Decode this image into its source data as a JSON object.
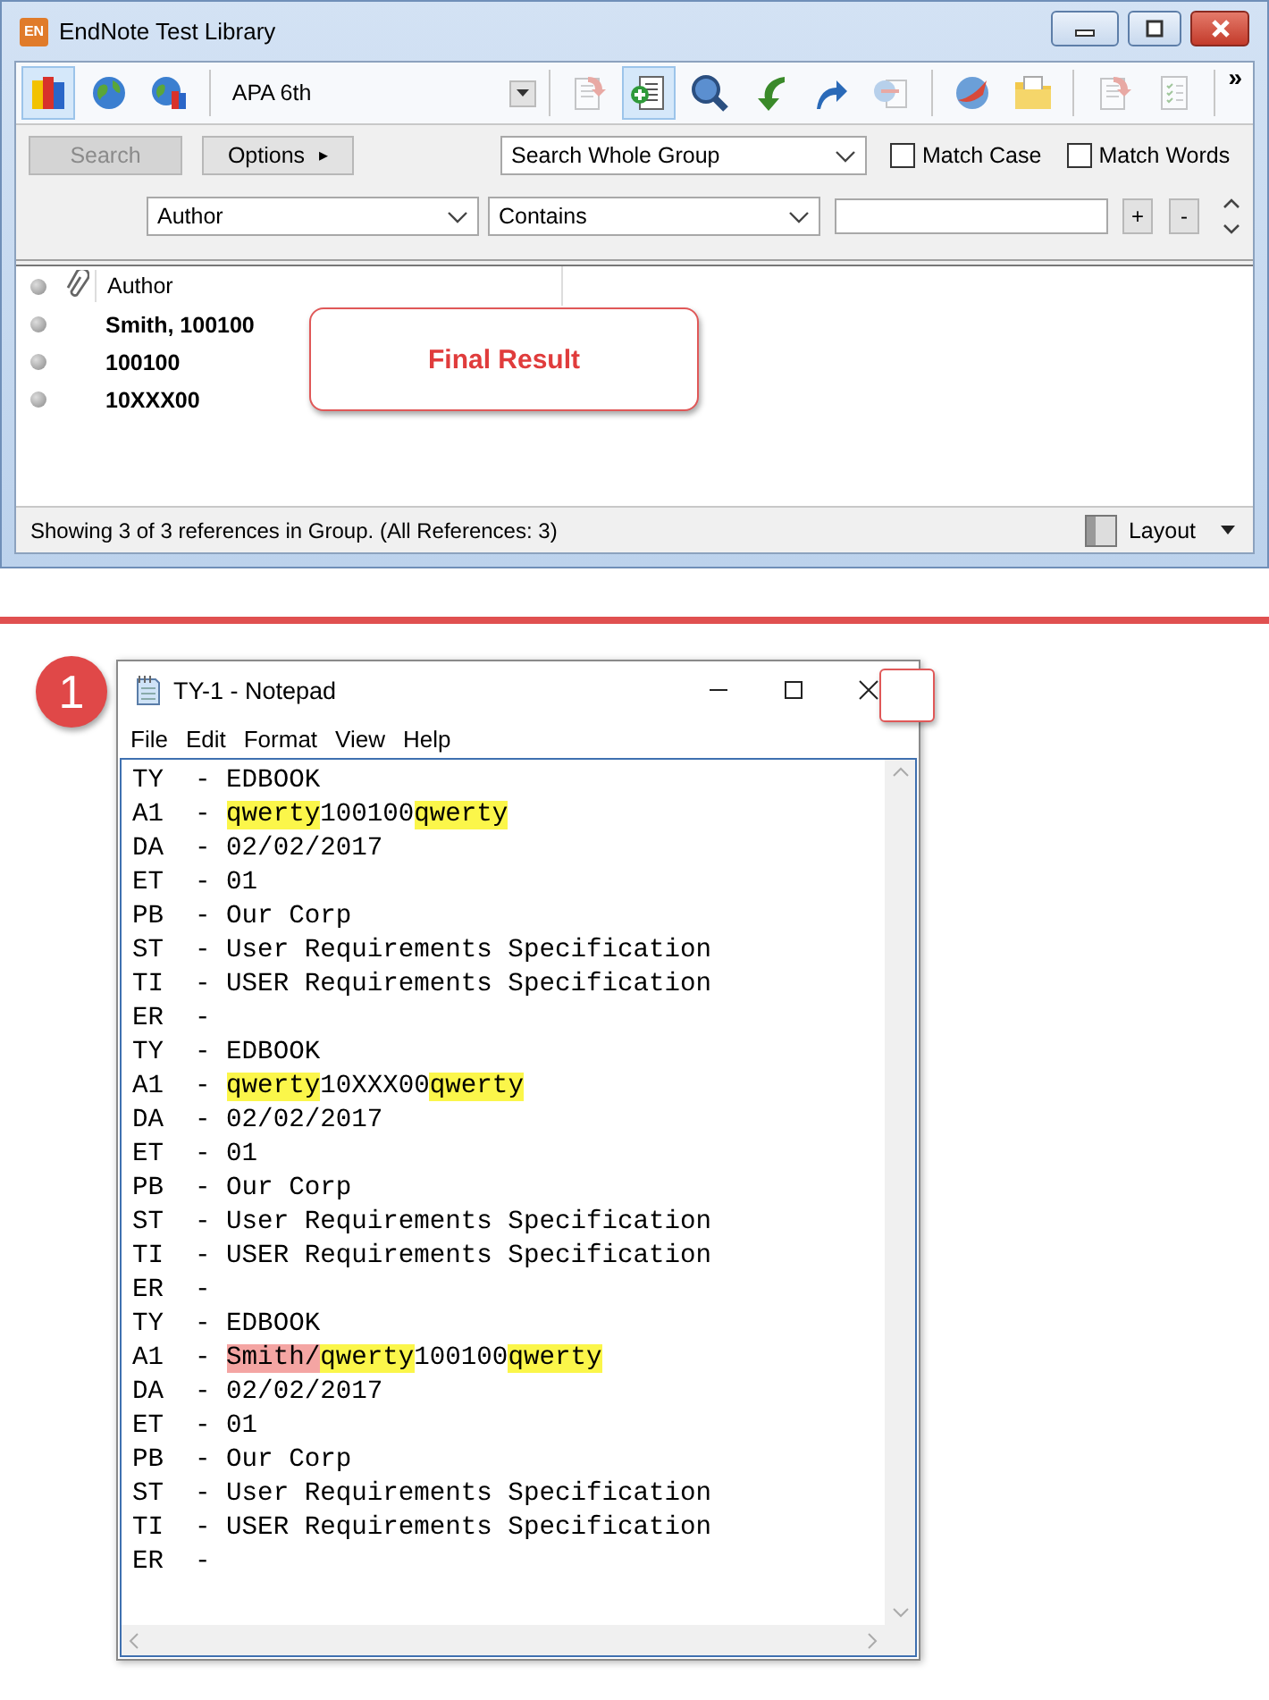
{
  "endnote_window": {
    "title": "EndNote Test Library",
    "app_icon_text": "EN",
    "toolbar_left": [
      {
        "kind": "books",
        "selected": true,
        "disabled": false
      },
      {
        "kind": "globe",
        "selected": false,
        "disabled": false
      },
      {
        "kind": "globe-books",
        "selected": false,
        "disabled": false
      }
    ],
    "style_select": {
      "value": "APA 6th"
    },
    "toolbar_right": [
      {
        "kind": "document-arrow",
        "selected": false,
        "disabled": true
      },
      {
        "kind": "add-document",
        "selected": true,
        "disabled": false
      },
      {
        "kind": "magnifier",
        "selected": false,
        "disabled": false
      },
      {
        "kind": "green-arrow",
        "selected": false,
        "disabled": false
      },
      {
        "kind": "blue-arrow",
        "selected": false,
        "disabled": false
      },
      {
        "kind": "globe-document",
        "selected": false,
        "disabled": true
      },
      {
        "kind": "globe-swoosh",
        "selected": false,
        "disabled": false
      },
      {
        "kind": "folder",
        "selected": false,
        "disabled": false
      },
      {
        "kind": "document-arrow",
        "selected": false,
        "disabled": true
      },
      {
        "kind": "checklist",
        "selected": false,
        "disabled": true
      }
    ],
    "toolbar_overflow": "»",
    "search_panel": {
      "search_button": {
        "label": "Search",
        "disabled": true
      },
      "options_button": {
        "label": "Options",
        "caret": "▸"
      },
      "scope_select": {
        "value": "Search Whole Group"
      },
      "checkboxes": [
        {
          "label": "Match Case",
          "checked": false
        },
        {
          "label": "Match Words",
          "checked": false
        }
      ],
      "field_select": {
        "value": "Author"
      },
      "operator_select": {
        "value": "Contains"
      },
      "add_button": "+",
      "remove_button": "-"
    },
    "reference_list": {
      "columns": [
        "Author"
      ],
      "rows": [
        {
          "author": "Smith, 100100"
        },
        {
          "author": "100100"
        },
        {
          "author": "10XXX00"
        }
      ]
    },
    "callout": "Final Result",
    "status_bar": {
      "text": "Showing 3 of 3 references in Group. (All References: 3)",
      "layout_button": "Layout"
    }
  },
  "step_badge": "1",
  "notepad_window": {
    "title": "TY-1 - Notepad",
    "menu": [
      "File",
      "Edit",
      "Format",
      "View",
      "Help"
    ],
    "lines": [
      {
        "text": "TY  - EDBOOK"
      },
      {
        "segments": [
          {
            "text": "A1  - "
          },
          {
            "text": "qwerty",
            "color": "#fbf64a"
          },
          {
            "text": "100100"
          },
          {
            "text": "qwerty",
            "color": "#fbf64a"
          }
        ]
      },
      {
        "text": "DA  - 02/02/2017"
      },
      {
        "text": "ET  - 01"
      },
      {
        "text": "PB  - Our Corp"
      },
      {
        "text": "ST  - User Requirements Specification"
      },
      {
        "text": "TI  - USER Requirements Specification"
      },
      {
        "text": "ER  -"
      },
      {
        "text": "TY  - EDBOOK"
      },
      {
        "segments": [
          {
            "text": "A1  - "
          },
          {
            "text": "qwerty",
            "color": "#fbf64a"
          },
          {
            "text": "10XXX00"
          },
          {
            "text": "qwerty",
            "color": "#fbf64a"
          }
        ]
      },
      {
        "text": "DA  - 02/02/2017"
      },
      {
        "text": "ET  - 01"
      },
      {
        "text": "PB  - Our Corp"
      },
      {
        "text": "ST  - User Requirements Specification"
      },
      {
        "text": "TI  - USER Requirements Specification"
      },
      {
        "text": "ER  -"
      },
      {
        "text": "TY  - EDBOOK"
      },
      {
        "segments": [
          {
            "text": "A1  - "
          },
          {
            "text": "Smith/",
            "color": "#f4a5a3"
          },
          {
            "text": "qwerty",
            "color": "#fbf64a"
          },
          {
            "text": "100100"
          },
          {
            "text": "qwerty",
            "color": "#fbf64a"
          }
        ]
      },
      {
        "text": "DA  - 02/02/2017"
      },
      {
        "text": "ET  - 01"
      },
      {
        "text": "PB  - Our Corp"
      },
      {
        "text": "ST  - User Requirements Specification"
      },
      {
        "text": "TI  - USER Requirements Specification"
      },
      {
        "text": "ER  -"
      }
    ]
  }
}
